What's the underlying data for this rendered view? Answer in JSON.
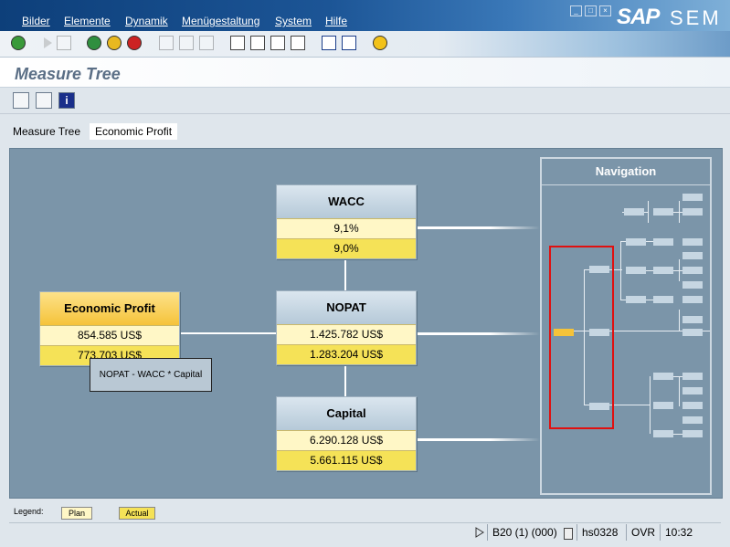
{
  "menu": {
    "items": [
      "Bilder",
      "Elemente",
      "Dynamik",
      "Menügestaltung",
      "System",
      "Hilfe"
    ]
  },
  "logo": {
    "sap": "SAP",
    "product": "SEM"
  },
  "page": {
    "title": "Measure Tree"
  },
  "tabs": [
    {
      "label": "Measure Tree",
      "active": false
    },
    {
      "label": "Economic Profit",
      "active": true
    }
  ],
  "nodes": {
    "economic_profit": {
      "title": "Economic Profit",
      "plan": "854.585 US$",
      "actual": "773.703 US$"
    },
    "wacc": {
      "title": "WACC",
      "plan": "9,1%",
      "actual": "9,0%"
    },
    "nopat": {
      "title": "NOPAT",
      "plan": "1.425.782 US$",
      "actual": "1.283.204 US$"
    },
    "capital": {
      "title": "Capital",
      "plan": "6.290.128 US$",
      "actual": "5.661.115 US$"
    }
  },
  "tooltip": "NOPAT - WACC * Capital",
  "navigation": {
    "title": "Navigation"
  },
  "legend": {
    "label": "Legend:",
    "plan": "Plan",
    "actual": "Actual"
  },
  "status": {
    "system": "B20 (1) (000)",
    "server": "hs0328",
    "mode": "OVR",
    "time": "10:32"
  },
  "colors": {
    "menubar": "#1c5596",
    "canvas": "#7b95a9",
    "plan": "#fff7c6",
    "actual": "#f5e257",
    "highlight_node": "#f5c33a",
    "nav_frame": "#e01010"
  },
  "icons": {
    "toolbar": [
      "check-icon",
      "triangle-icon",
      "save-icon",
      "back-icon",
      "exit-icon",
      "cancel-icon",
      "print-icon",
      "find-icon",
      "find-next-icon",
      "first-page-icon",
      "prev-page-icon",
      "next-page-icon",
      "last-page-icon",
      "new-session-icon",
      "shortcut-icon",
      "help-icon"
    ],
    "app": [
      "expand-icon",
      "collapse-icon",
      "info-icon"
    ]
  }
}
